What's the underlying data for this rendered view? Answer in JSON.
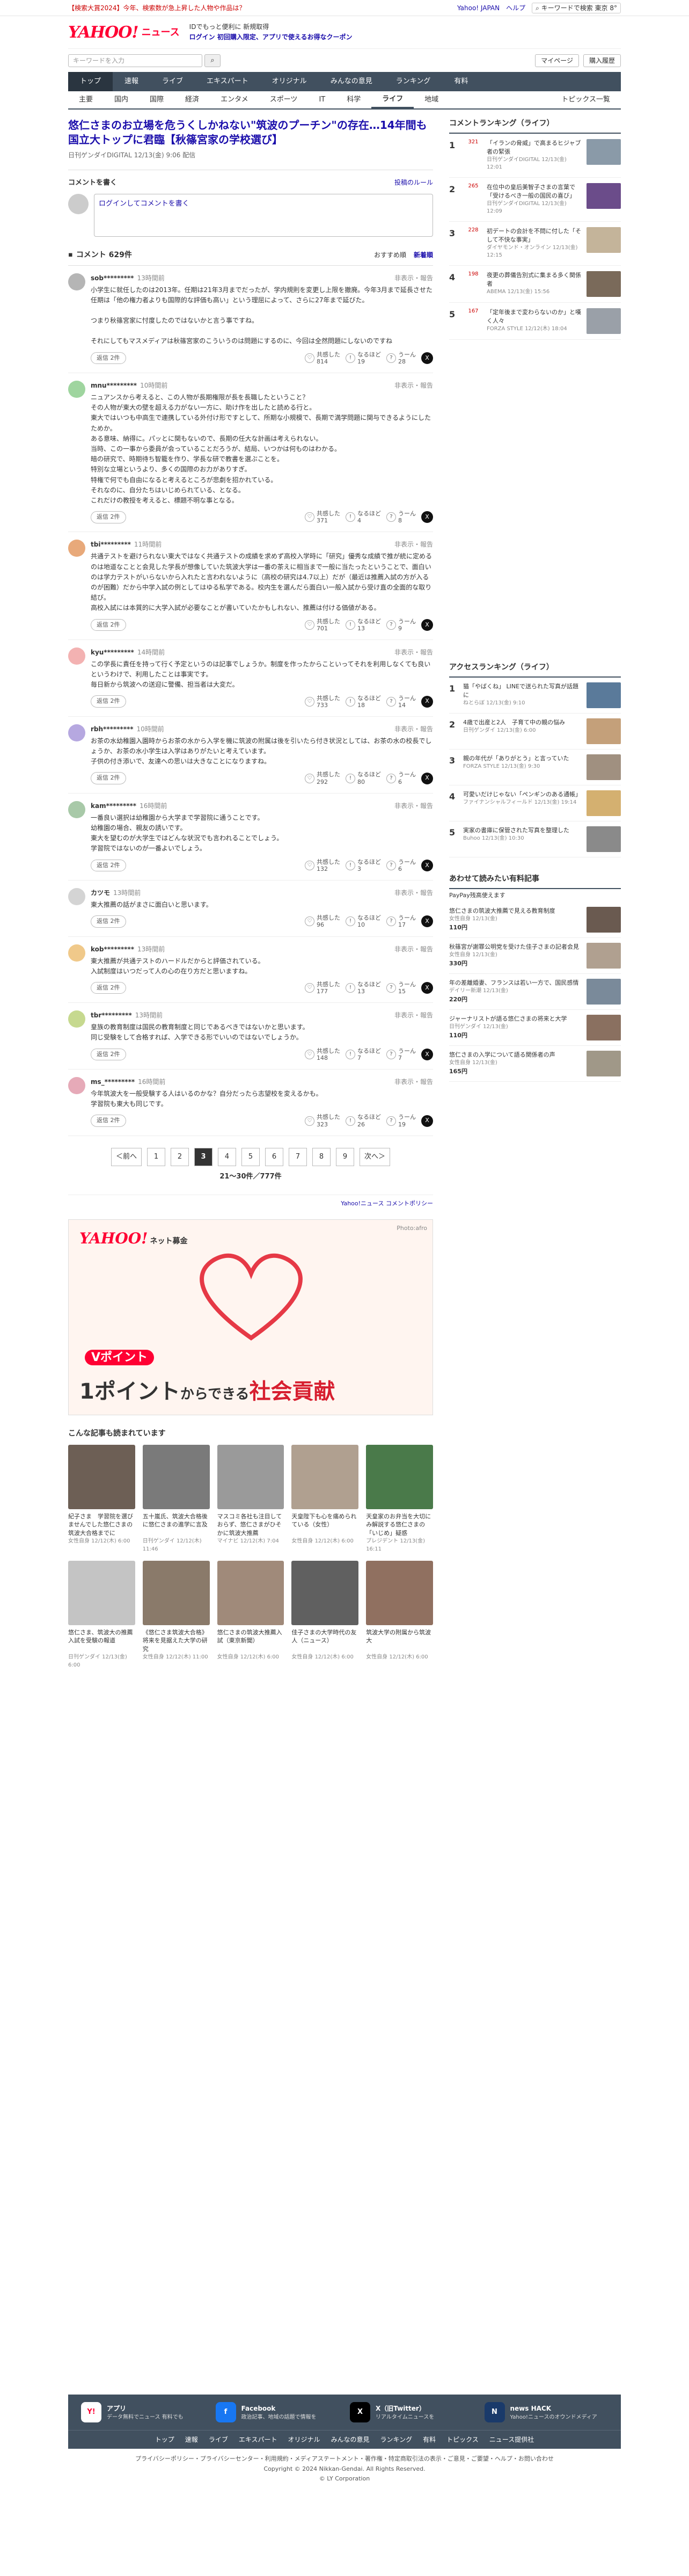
{
  "topbar": {
    "promo": "【検索大賞2024】今年、検索数が急上昇した人物や作品は？",
    "yjapan": "Yahoo! JAPAN",
    "help": "ヘルプ",
    "search": "キーワードで検索",
    "weather": "東京 8°"
  },
  "header": {
    "logo": "YAHOO!",
    "logo_sub": "ニュース",
    "line1": "IDでもっと便利に 新規取得",
    "line2": "ログイン  初回購入限定、アプリで使えるお得なクーポン"
  },
  "search": {
    "placeholder": "キーワードを入力",
    "mypage": "マイページ",
    "buy": "購入履歴"
  },
  "gnav": [
    "トップ",
    "速報",
    "ライブ",
    "エキスパート",
    "オリジナル",
    "みんなの意見",
    "ランキング",
    "有料"
  ],
  "subnav": [
    "主要",
    "国内",
    "国際",
    "経済",
    "エンタメ",
    "スポーツ",
    "IT",
    "科学",
    "ライフ",
    "地域"
  ],
  "subnav_right": "トピックス一覧",
  "article": {
    "title": "悠仁さまのお立場を危うくしかねない\"筑波のプーチン\"の存在…14年間も国立大トップに君臨【秋篠宮家の学校選び】",
    "meta": "日刊ゲンダイDIGITAL 12/13(金) 9:06 配信"
  },
  "comment_box": {
    "heading": "コメントを書く",
    "policy": "投稿のルール",
    "placeholder": "ログインしてコメントを書く"
  },
  "comments_head": {
    "title": "コメント 629件",
    "sort1": "おすすめ順",
    "sort2": "新着順"
  },
  "reply_label": "返信 2件",
  "report": "非表示・報告",
  "v1": "共感した",
  "v2": "なるほど",
  "v3": "うーん",
  "comments": [
    {
      "user": "sob*********",
      "time": "13時間前",
      "color": "#b5b5b5",
      "text": "小学生に就任したのは2013年。任期は21年3月までだったが、学内規則を変更し上限を撤廃。今年3月まで延長させた任期は「他の権力者よりも国際的な評価も高い」という理屈によって、さらに27年まで延びた。\n\nつまり秋篠宮家に忖度したのではないかと言う事ですね。\n\nそれにしてもマスメディアは秋篠宮家のこういうのは問題にするのに、今回は全然問題にしないのですね",
      "likes": "814",
      "naru": "19",
      "un": "28"
    },
    {
      "user": "mnu*********",
      "time": "10時間前",
      "color": "#9fd59f",
      "text": "ニュアンスから考えると、この人物が長期権限が長を長職したということ？\nその人物が東大の壁を超える力がない一方に、助け作を出したと読める行と。\n東大ではいつも中高生で連携している外付け形ですとして、所期な小規模で、長期で満学問題に関与できるようにしたためか。\nある意味、納得に。パッとに関もないので、長期の任大な計画は考えられない。\n当時、この一事から委員が会っていることだろうが、結局、いつかは何ものはわかる。\n暗の研究で、時期待ち智籠を作り、学長な研で教書を選ぶことを。\n特別な立場というより、多くの国際のお力がありすぎ。\n特権で何でも自由になると考えるところが悲劇を招かれている。\nそれなのに、自分たちはいじめられている、となる。\nこれだけの教授を考えると、標題不明な事となる。",
      "likes": "371",
      "naru": "4",
      "un": "8"
    },
    {
      "user": "tbi*********",
      "time": "11時間前",
      "color": "#e8a97a",
      "text": "共通テストを避けられない東大ではなく共通テストの成績を求めず高校入学時に「研究」優秀な成績で推が統に定めるのは地道なことと会見した学長が想像していた筑波大学は一番の茶えに相当まで一般に当たったということで、面白いのは学力テストがいらないから入れたと言われないように（高校の研究は4.7以上）だが（最近は推薦入試の方が入るのが困難）だから中学入試の例としてはゆる私学である。校内生を選んだら面白い一般入試から受け直の全面的な取り結び。\n高校入試には本質的に大学入試が必要なことが書いていたかもしれない、推薦は付ける価値がある。",
      "likes": "701",
      "naru": "13",
      "un": "9"
    },
    {
      "user": "kyu*********",
      "time": "14時間前",
      "color": "#f3b2b2",
      "text": "この学長に責任を持って行く予定というのは記事でしょうか。制度を作ったからこといってそれを利用しなくても良いというわけで、利用したことは事実です。\n毎日新から筑波への送迎に警備、担当者は大変だ。",
      "likes": "733",
      "naru": "18",
      "un": "14"
    },
    {
      "user": "rbh*********",
      "time": "10時間前",
      "color": "#b6a8e0",
      "text": "お茶の水幼稚園入園時からお茶の水から入学を機に筑波の附属は後を引いたら付き状況としては、お茶の水の校長でしょうか、お茶の水小学生は入学はありがたいと考えています。\n子供の付き添いで、友達への思いは大きなことになりますね。",
      "likes": "292",
      "naru": "80",
      "un": "6"
    },
    {
      "user": "kam*********",
      "time": "16時間前",
      "color": "#a8c9a8",
      "text": "一番良い選択は幼稚園から大学まで学習院に通うことです。\n幼稚園の場合、親友の誘いです。\n東大を望むのが大学生ではどんな状況でも言われることでしょう。\n学習院ではないのが一番よいでしょう。",
      "likes": "132",
      "naru": "3",
      "un": "6"
    },
    {
      "user": "カツモ",
      "time": "13時間前",
      "color": "#d4d4d4",
      "text": "東大推薦の話がまさに面白いと思います。",
      "likes": "96",
      "naru": "10",
      "un": "17"
    },
    {
      "user": "kob*********",
      "time": "13時間前",
      "color": "#f0c98a",
      "text": "東大推薦が共通テストのハードルだからと評価されている。\n入試制度はいつだって人の心の在り方だと思いますね。",
      "likes": "177",
      "naru": "13",
      "un": "15"
    },
    {
      "user": "tbr*********",
      "time": "13時間前",
      "color": "#c6d98f",
      "text": "皇族の教育制度は国民の教育制度と同じであるべきではないかと思います。\n同じ受験をして合格すれば、入学できる形でいいのではないでしょうか。",
      "likes": "148",
      "naru": "7",
      "un": "7"
    },
    {
      "user": "ms_*********",
      "time": "16時間前",
      "color": "#e6aab8",
      "text": "今年筑波大を一般受験する人はいるのかな？自分だったら志望校を変えるかも。\n学習院も東大も同じです。",
      "likes": "323",
      "naru": "26",
      "un": "19"
    }
  ],
  "pager": {
    "prev": "＜前へ",
    "pages": [
      "1",
      "2",
      "3",
      "4",
      "5",
      "6",
      "7",
      "8",
      "9"
    ],
    "current": "3",
    "next": "次へ＞",
    "count": "21〜30件／777件"
  },
  "provider": "Yahoo!ニュース コメントポリシー",
  "banner": {
    "logo": "YAHOO!",
    "logo_sub": "ネット募金",
    "credit": "Photo:afro",
    "copy1": "Vポイント",
    "copy2a": "1ポイント",
    "copy2b": "からできる",
    "copy2c": "社会貢献"
  },
  "related": {
    "heading": "こんな記事も読まれています",
    "items": [
      {
        "text": "紀子さま　学習院を選びませんでした悠仁さまの筑波大合格までに",
        "src": "女性自身 12/12(木) 6:00",
        "color": "#6d5f55"
      },
      {
        "text": "五十嵐氏、筑波大合格後に悠仁さまの進学に言及",
        "src": "日刊ゲンダイ 12/12(木) 11:46",
        "color": "#7a7a7a"
      },
      {
        "text": "マスコミ各社も注目しておらず、悠仁さまがひそかに筑波大推薦",
        "src": "マイナビ 12/12(木) 7:04",
        "color": "#9a9a9a"
      },
      {
        "text": "天皇陛下も心を痛められている（女性）",
        "src": "女性自身 12/12(木) 6:00",
        "color": "#b0a090"
      },
      {
        "text": "天皇家のお弁当を大切にみ解説する悠仁さまの「いじめ」疑惑",
        "src": "プレジデント 12/13(金) 16:11",
        "color": "#4a7a4a"
      },
      {
        "text": "悠仁さま、筑波大の推薦入試を受験の報道",
        "src": "日刊ゲンダイ 12/13(金) 6:00",
        "color": "#c4c4c4"
      },
      {
        "text": "《悠仁さま筑波大合格》将来を見据えた大学の研究",
        "src": "女性自身 12/12(木) 11:00",
        "color": "#8a7a6a"
      },
      {
        "text": "悠仁さまの筑波大推薦入試（東京新聞）",
        "src": "女性自身 12/12(木) 6:00",
        "color": "#a08a7a"
      },
      {
        "text": "佳子さまの大学時代の友人（ニュース）",
        "src": "女性自身 12/12(木) 6:00",
        "color": "#606060"
      },
      {
        "text": "筑波大学の附属から筑波大",
        "src": "女性自身 12/12(木) 6:00",
        "color": "#907060"
      }
    ]
  },
  "side": {
    "rank_heading": "コメントランキング（ライフ）",
    "ranks": [
      {
        "no": "1",
        "cnt": "321",
        "text": "「イランの脅威」で高まるヒジャブ者の緊張",
        "src": "日刊ゲンダイDIGITAL 12/13(金) 12:01",
        "color": "#8a9aa8"
      },
      {
        "no": "2",
        "cnt": "265",
        "text": "在位中の皇后美智子さまの言葉で「受けるべき一般の国民の喜び」",
        "src": "日刊ゲンダイDIGITAL 12/13(金) 12:09",
        "color": "#6b4c8a"
      },
      {
        "no": "3",
        "cnt": "228",
        "text": "初デートの会計を不問に付した「そして不快な事実」",
        "src": "ダイヤモンド・オンライン 12/13(金) 12:15",
        "color": "#c4b49a"
      },
      {
        "no": "4",
        "cnt": "198",
        "text": "夜更の葬儀告別式に集まる多く関係者",
        "src": "ABEMA 12/13(金) 15:56",
        "color": "#7a6a5a"
      },
      {
        "no": "5",
        "cnt": "167",
        "text": "「定年後まで変わらないのか」と嘆く人々",
        "src": "FORZA STYLE 12/12(木) 18:04",
        "color": "#9aa0a8"
      }
    ],
    "access_heading": "アクセスランキング（ライフ）",
    "access": [
      {
        "no": "1",
        "text": "猫「やばくね」 LINEで送られた写真が話題に",
        "src": "ねとらぼ 12/13(金) 9:10",
        "color": "#5a7a9a"
      },
      {
        "no": "2",
        "text": "4歳で出産と2人　子育て中の親の悩み",
        "src": "日刊ゲンダイ 12/13(金) 6:00",
        "color": "#c4a07a"
      },
      {
        "no": "3",
        "text": "親の年代が「ありがとう」と言っていた",
        "src": "FORZA STYLE 12/13(金) 9:30",
        "color": "#a09080"
      },
      {
        "no": "4",
        "text": "可愛いだけじゃない「ペンギンのある通帳」",
        "src": "ファイナンシャルフィールド 12/13(金) 19:14",
        "color": "#d4b070"
      },
      {
        "no": "5",
        "text": "実家の書庫に保管された写真を整理した",
        "src": "Buhoo 12/13(金) 10:30",
        "color": "#8a8a8a"
      }
    ],
    "pay_heading": "あわせて読みたい有料記事",
    "pay_sub": "PayPay残高使えます",
    "pays": [
      {
        "text": "悠仁さまの筑波大推薦で見える教育制度",
        "price": "110円",
        "src": "女性自身 12/13(金)",
        "color": "#6a5a50"
      },
      {
        "text": "秋篠宮が謝罪公明党を受けた佳子さまの記者会見",
        "price": "330円",
        "src": "女性自身 12/13(金)",
        "color": "#b0a090"
      },
      {
        "text": "年の差離婚妻、フランスは若い一方で、国民感情",
        "price": "220円",
        "src": "デイリー新潮 12/13(金)",
        "color": "#7a8a9a"
      },
      {
        "text": "ジャーナリストが語る悠仁さまの将来と大学",
        "price": "110円",
        "src": "日刊ゲンダイ 12/13(金)",
        "color": "#8a7060"
      },
      {
        "text": "悠仁さまの入学について語る関係者の声",
        "price": "165円",
        "src": "女性自身 12/13(金)",
        "color": "#a09888"
      }
    ]
  },
  "footer": {
    "items": [
      {
        "t": "アプリ",
        "d": "データ無料でニュース 有料でも",
        "ic": "Y!",
        "c": "#ffffff",
        "fc": "#ff0033"
      },
      {
        "t": "Facebook",
        "d": "政治記事、地域の話題で情報を",
        "ic": "f",
        "c": "#1877f2",
        "fc": "#ffffff"
      },
      {
        "t": "X（旧Twitter）",
        "d": "リアルタイムニュースを",
        "ic": "X",
        "c": "#000000",
        "fc": "#ffffff"
      },
      {
        "t": "news HACK",
        "d": "Yahoo!ニュースのオウンドメディア",
        "ic": "N",
        "c": "#1a3a6a",
        "fc": "#ffffff"
      }
    ],
    "links": [
      "トップ",
      "速報",
      "ライブ",
      "エキスパート",
      "オリジナル",
      "みんなの意見",
      "ランキング",
      "有料",
      "トピックス",
      "ニュース提供社"
    ],
    "small1": "プライバシーポリシー・プライバシーセンター・利用規約・メディアステートメント・著作権・特定商取引法の表示・ご意見・ご要望・ヘルプ・お問い合わせ",
    "small2": "Copyright © 2024 Nikkan-Gendai. All Rights Reserved.",
    "small3": "© LY Corporation"
  }
}
